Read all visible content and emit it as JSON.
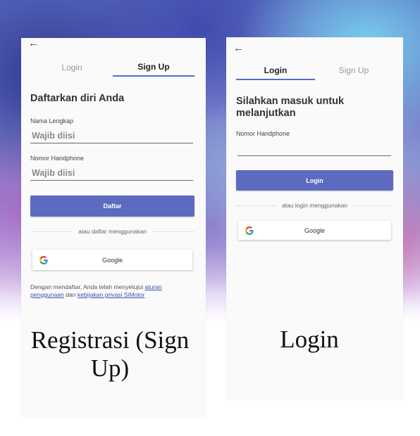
{
  "signup_screen": {
    "back_icon": "arrow-left-icon",
    "tabs": [
      {
        "label": "Login",
        "active": false
      },
      {
        "label": "Sign Up",
        "active": true
      }
    ],
    "heading": "Daftarkan diri Anda",
    "full_name": {
      "label": "Nama Lengkap",
      "placeholder": "Wajib diisi"
    },
    "phone": {
      "label": "Nomor Handphone",
      "placeholder": "Wajib diisi"
    },
    "submit_label": "Daftar",
    "divider_text": "atau daftar menggunakan",
    "google_label": "Google",
    "terms": {
      "prefix": "Dengan mendaftar, Anda telah menyetujui",
      "link1": "aturan penggunaan",
      "middle": "dan",
      "link2": "kebijakan privasi SiMotor"
    }
  },
  "login_screen": {
    "back_icon": "arrow-left-icon",
    "tabs": [
      {
        "label": "Login",
        "active": true
      },
      {
        "label": "Sign Up",
        "active": false
      }
    ],
    "heading": "Silahkan masuk untuk melanjutkan",
    "phone": {
      "label": "Nomor Handphone",
      "value": ""
    },
    "submit_label": "Login",
    "divider_text": "atau login menggunakan",
    "google_label": "Google"
  },
  "captions": {
    "signup": "Registrasi (Sign Up)",
    "login": "Login"
  },
  "colors": {
    "accent": "#5c6bc0",
    "link": "#3f51b5",
    "screen_bg": "#fafafa"
  }
}
